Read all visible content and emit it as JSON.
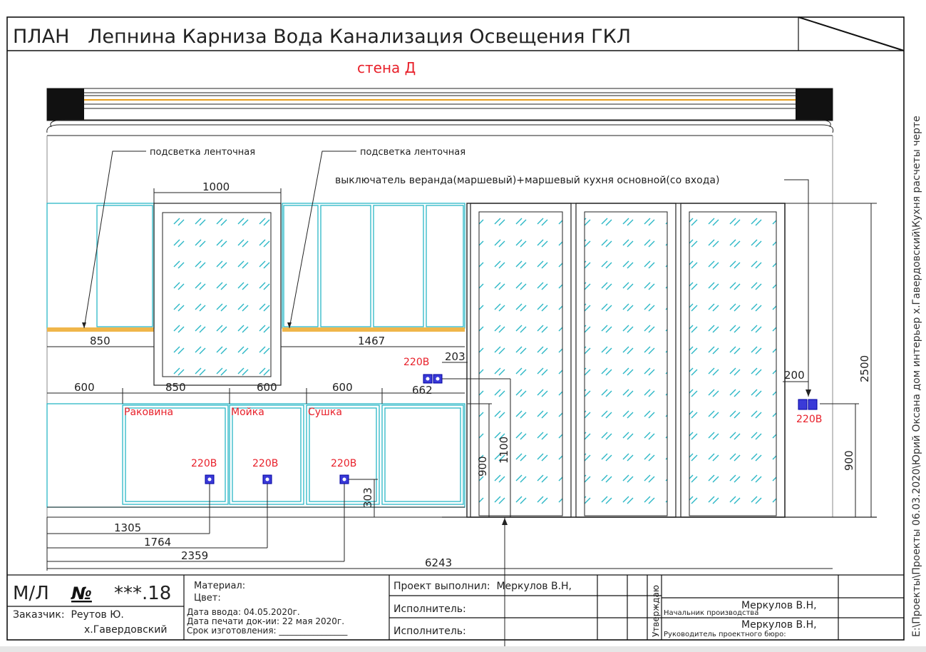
{
  "header": {
    "title": "ПЛАН   Лепнина Карниза Вода Канализация Освещения ГКЛ",
    "wall": "стена Д"
  },
  "side_path": "E:\\Проекты\\Проекты 06.03.2020\\Юрий Оксана дом интерьер х.Гавердовский\\Кухня расчеты черте",
  "labels": {
    "led1": "подсветка ленточная",
    "led2": "подсветка ленточная",
    "switch": "выключатель веранда(маршевый)+маршевый кухня основной(со входа)",
    "sink": "Раковина",
    "wash": "Мойка",
    "dryer": "Сушка",
    "v220_a": "220В",
    "v220_b": "220В",
    "v220_c": "220В",
    "v220_d": "220В",
    "v220_e": "220В"
  },
  "dims": {
    "d1000": "1000",
    "d850a": "850",
    "d1467": "1467",
    "d203": "203",
    "d600a": "600",
    "d850b": "850",
    "d600b": "600",
    "d600c": "600",
    "d662": "662",
    "d200": "200",
    "d2500": "2500",
    "d900a": "900",
    "d1100": "1100",
    "d900b": "900",
    "d303": "303",
    "d1305": "1305",
    "d1764": "1764",
    "d2359": "2359",
    "d6243": "6243"
  },
  "title_block": {
    "ml": "М/Л",
    "no": "№",
    "num": "***.18",
    "material": "Материал:",
    "color": "Цвет:",
    "customer": "Заказчик:  Реутов Ю.",
    "customer2": "х.Гавердовский",
    "date_in": "Дата ввода: 04.05.2020г.",
    "date_print": "Дата печати док-ии: 22 мая 2020г.",
    "deadline": "Срок изготовления: ________________",
    "project_by": "Проект выполнил:  Меркулов В.Н,",
    "executor1": "Исполнитель:",
    "executor2": "Исполнитель:",
    "approved": "Утверждаю",
    "name1": "Меркулов В.Н,",
    "role1": "Начальник производства",
    "name2": "Меркулов В.Н,",
    "role2": "Руководитель проектного бюро:"
  }
}
